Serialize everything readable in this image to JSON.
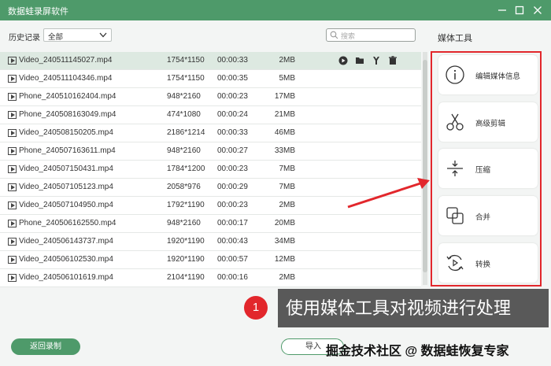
{
  "window": {
    "title": "数据蛙录屏软件",
    "controls": [
      "minimize",
      "maximize",
      "close"
    ]
  },
  "history": {
    "label": "历史记录",
    "filter_value": "全部",
    "search_placeholder": "搜索"
  },
  "files": [
    {
      "name": "Video_240511145027.mp4",
      "resolution": "1754*1150",
      "duration": "00:00:33",
      "size": "2MB",
      "selected": true
    },
    {
      "name": "Video_240511104346.mp4",
      "resolution": "1754*1150",
      "duration": "00:00:35",
      "size": "5MB"
    },
    {
      "name": "Phone_240510162404.mp4",
      "resolution": "948*2160",
      "duration": "00:00:23",
      "size": "17MB"
    },
    {
      "name": "Phone_240508163049.mp4",
      "resolution": "474*1080",
      "duration": "00:00:24",
      "size": "21MB"
    },
    {
      "name": "Video_240508150205.mp4",
      "resolution": "2186*1214",
      "duration": "00:00:33",
      "size": "46MB"
    },
    {
      "name": "Phone_240507163611.mp4",
      "resolution": "948*2160",
      "duration": "00:00:27",
      "size": "33MB"
    },
    {
      "name": "Video_240507150431.mp4",
      "resolution": "1784*1200",
      "duration": "00:00:23",
      "size": "7MB"
    },
    {
      "name": "Video_240507105123.mp4",
      "resolution": "2058*976",
      "duration": "00:00:29",
      "size": "7MB"
    },
    {
      "name": "Video_240507104950.mp4",
      "resolution": "1792*1190",
      "duration": "00:00:23",
      "size": "2MB"
    },
    {
      "name": "Phone_240506162550.mp4",
      "resolution": "948*2160",
      "duration": "00:00:17",
      "size": "20MB"
    },
    {
      "name": "Video_240506143737.mp4",
      "resolution": "1920*1190",
      "duration": "00:00:43",
      "size": "34MB"
    },
    {
      "name": "Video_240506102530.mp4",
      "resolution": "1920*1190",
      "duration": "00:00:57",
      "size": "12MB"
    },
    {
      "name": "Video_240506101619.mp4",
      "resolution": "2104*1190",
      "duration": "00:00:16",
      "size": "2MB"
    }
  ],
  "row_actions": [
    "play-icon",
    "folder-icon",
    "tool-icon",
    "trash-icon"
  ],
  "media_tools": {
    "title": "媒体工具",
    "items": [
      {
        "label": "编辑媒体信息",
        "icon": "info-icon"
      },
      {
        "label": "高级剪辑",
        "icon": "scissors-icon"
      },
      {
        "label": "压缩",
        "icon": "compress-icon"
      },
      {
        "label": "合并",
        "icon": "merge-icon"
      },
      {
        "label": "转换",
        "icon": "convert-icon"
      }
    ]
  },
  "footer": {
    "back_label": "返回录制",
    "import_label": "导入"
  },
  "annotation": {
    "number": "1",
    "text": "使用媒体工具对视频进行处理"
  },
  "watermark": "掘金技术社区 @ 数据蛙恢复专家",
  "colors": {
    "brand_green": "#4e9a6a",
    "annotation_red": "#e2272c",
    "callout_gray": "#595959"
  }
}
